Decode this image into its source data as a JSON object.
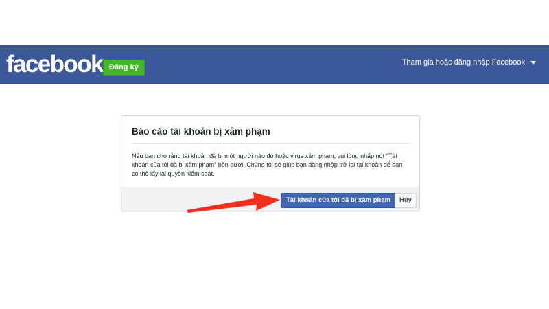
{
  "header": {
    "logo": "facebook",
    "signup_label": "Đăng ký",
    "login_prompt": "Tham gia hoặc đăng nhập Facebook",
    "brand_color": "#3b5998",
    "signup_color": "#42b72a"
  },
  "dialog": {
    "title": "Báo cáo tài khoản bị xâm phạm",
    "body": "Nếu bạn cho rằng tài khoản đã bị một người nào đó hoặc virus xâm phạm, vui lòng nhấp nút \"Tài khoản của tôi đã bị xâm phạm\" bên dưới. Chúng tôi sẽ giúp bạn đăng nhập trở lại tài khoản để bạn có thể lấy lại quyền kiểm soát.",
    "confirm_label": "Tài khoản của tôi đã bị xâm phạm",
    "cancel_label": "Hủy"
  },
  "annotation": {
    "arrow_color": "#f0301c",
    "points_to": "confirm-button"
  }
}
